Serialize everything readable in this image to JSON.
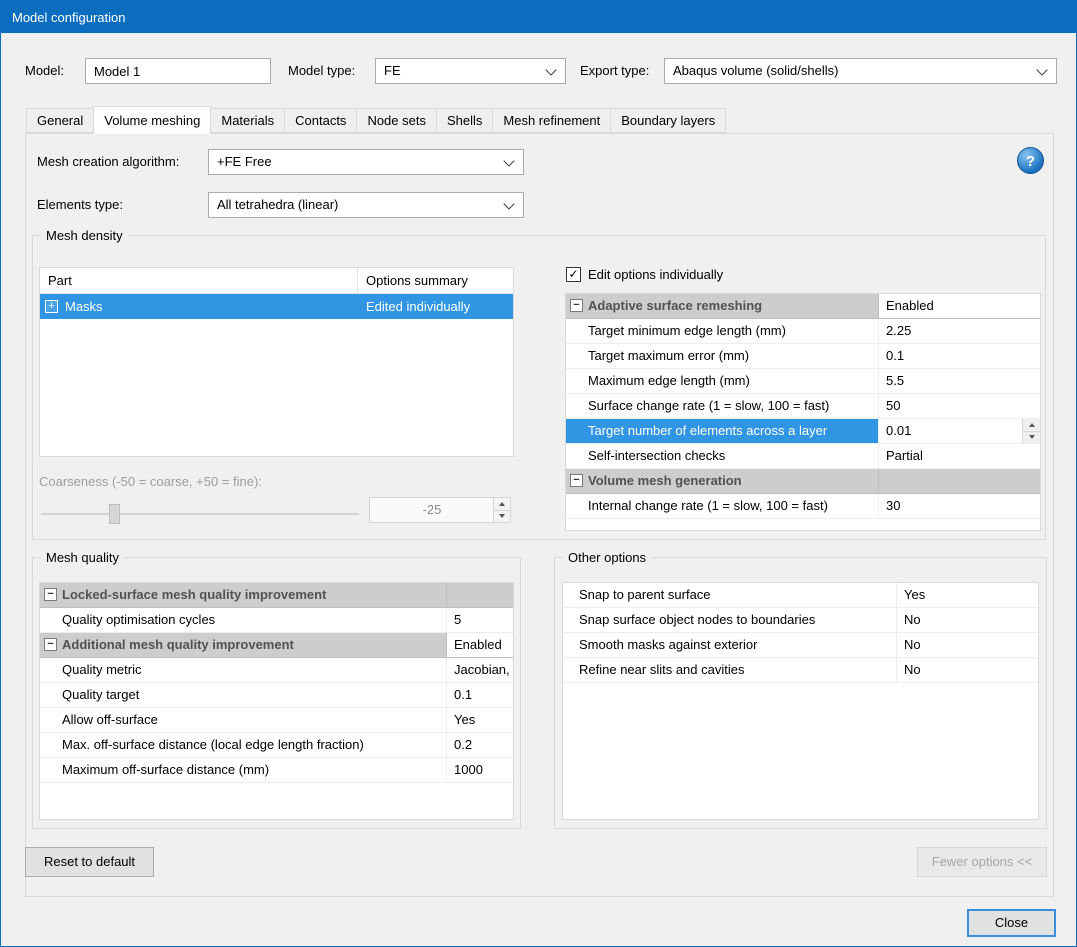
{
  "titlebar": {
    "title": "Model configuration"
  },
  "header": {
    "model_label": "Model:",
    "model_value": "Model 1",
    "model_type_label": "Model type:",
    "model_type_value": "FE",
    "export_type_label": "Export type:",
    "export_type_value": "Abaqus volume (solid/shells)"
  },
  "tabs": {
    "active": "Volume meshing",
    "items": [
      {
        "label": "General"
      },
      {
        "label": "Volume meshing"
      },
      {
        "label": "Materials"
      },
      {
        "label": "Contacts"
      },
      {
        "label": "Node sets"
      },
      {
        "label": "Shells"
      },
      {
        "label": "Mesh refinement"
      },
      {
        "label": "Boundary layers"
      }
    ]
  },
  "algorithm": {
    "label": "Mesh creation algorithm:",
    "value": "+FE Free"
  },
  "elements": {
    "label": "Elements type:",
    "value": "All tetrahedra (linear)"
  },
  "icons": {
    "help": "?",
    "check": "✓",
    "collapse": "−",
    "expand": "+"
  },
  "mesh_density": {
    "title": "Mesh density",
    "parts_table": {
      "columns": [
        "Part",
        "Options summary"
      ],
      "rows": [
        {
          "part": "Masks",
          "summary": "Edited individually",
          "selected": true
        }
      ]
    },
    "coarseness": {
      "label": "Coarseness (-50 = coarse, +50 = fine):",
      "value": "-25",
      "min": "-50",
      "max": "+50",
      "disabled": true
    },
    "edit_individually": {
      "label": "Edit options individually",
      "checked": true
    },
    "grid": {
      "rows": [
        {
          "type": "group",
          "name": "Adaptive surface remeshing",
          "value": "Enabled"
        },
        {
          "type": "item",
          "name": "Target minimum edge length (mm)",
          "value": "2.25"
        },
        {
          "type": "item",
          "name": "Target maximum error (mm)",
          "value": "0.1"
        },
        {
          "type": "item",
          "name": "Maximum edge length (mm)",
          "value": "5.5"
        },
        {
          "type": "item",
          "name": "Surface change rate (1 = slow, 100 = fast)",
          "value": "50"
        },
        {
          "type": "item",
          "name": "Target number of elements across a layer",
          "value": "0.01",
          "selected": true,
          "spinner": true
        },
        {
          "type": "item",
          "name": "Self-intersection checks",
          "value": "Partial"
        },
        {
          "type": "group",
          "name": "Volume mesh generation",
          "value": ""
        },
        {
          "type": "item",
          "name": "Internal change rate (1 = slow, 100 = fast)",
          "value": "30"
        }
      ]
    }
  },
  "mesh_quality": {
    "title": "Mesh quality",
    "grid": {
      "rows": [
        {
          "type": "group",
          "name": "Locked-surface mesh quality improvement",
          "value": ""
        },
        {
          "type": "item",
          "name": "Quality optimisation cycles",
          "value": "5"
        },
        {
          "type": "group",
          "name": "Additional mesh quality improvement",
          "value": "Enabled"
        },
        {
          "type": "item",
          "name": "Quality metric",
          "value": "Jacobian, in"
        },
        {
          "type": "item",
          "name": "Quality target",
          "value": "0.1"
        },
        {
          "type": "item",
          "name": "Allow off-surface",
          "value": "Yes"
        },
        {
          "type": "item",
          "name": "Max. off-surface distance (local edge length fraction)",
          "value": "0.2"
        },
        {
          "type": "item",
          "name": "Maximum off-surface distance (mm)",
          "value": "1000"
        }
      ]
    }
  },
  "other_options": {
    "title": "Other options",
    "grid": {
      "rows": [
        {
          "name": "Snap to parent surface",
          "value": "Yes"
        },
        {
          "name": "Snap surface object nodes to boundaries",
          "value": "No"
        },
        {
          "name": "Smooth masks against exterior",
          "value": "No"
        },
        {
          "name": "Refine near slits and cavities",
          "value": "No"
        }
      ]
    }
  },
  "buttons": {
    "reset": "Reset to default",
    "fewer_options": "Fewer options <<",
    "close": "Close"
  },
  "colors": {
    "titlebar": "#0b6dbd",
    "selection": "#3095e3",
    "group_header_bg": "#cdcdcd",
    "dialog_bg": "#f0f0f0"
  }
}
